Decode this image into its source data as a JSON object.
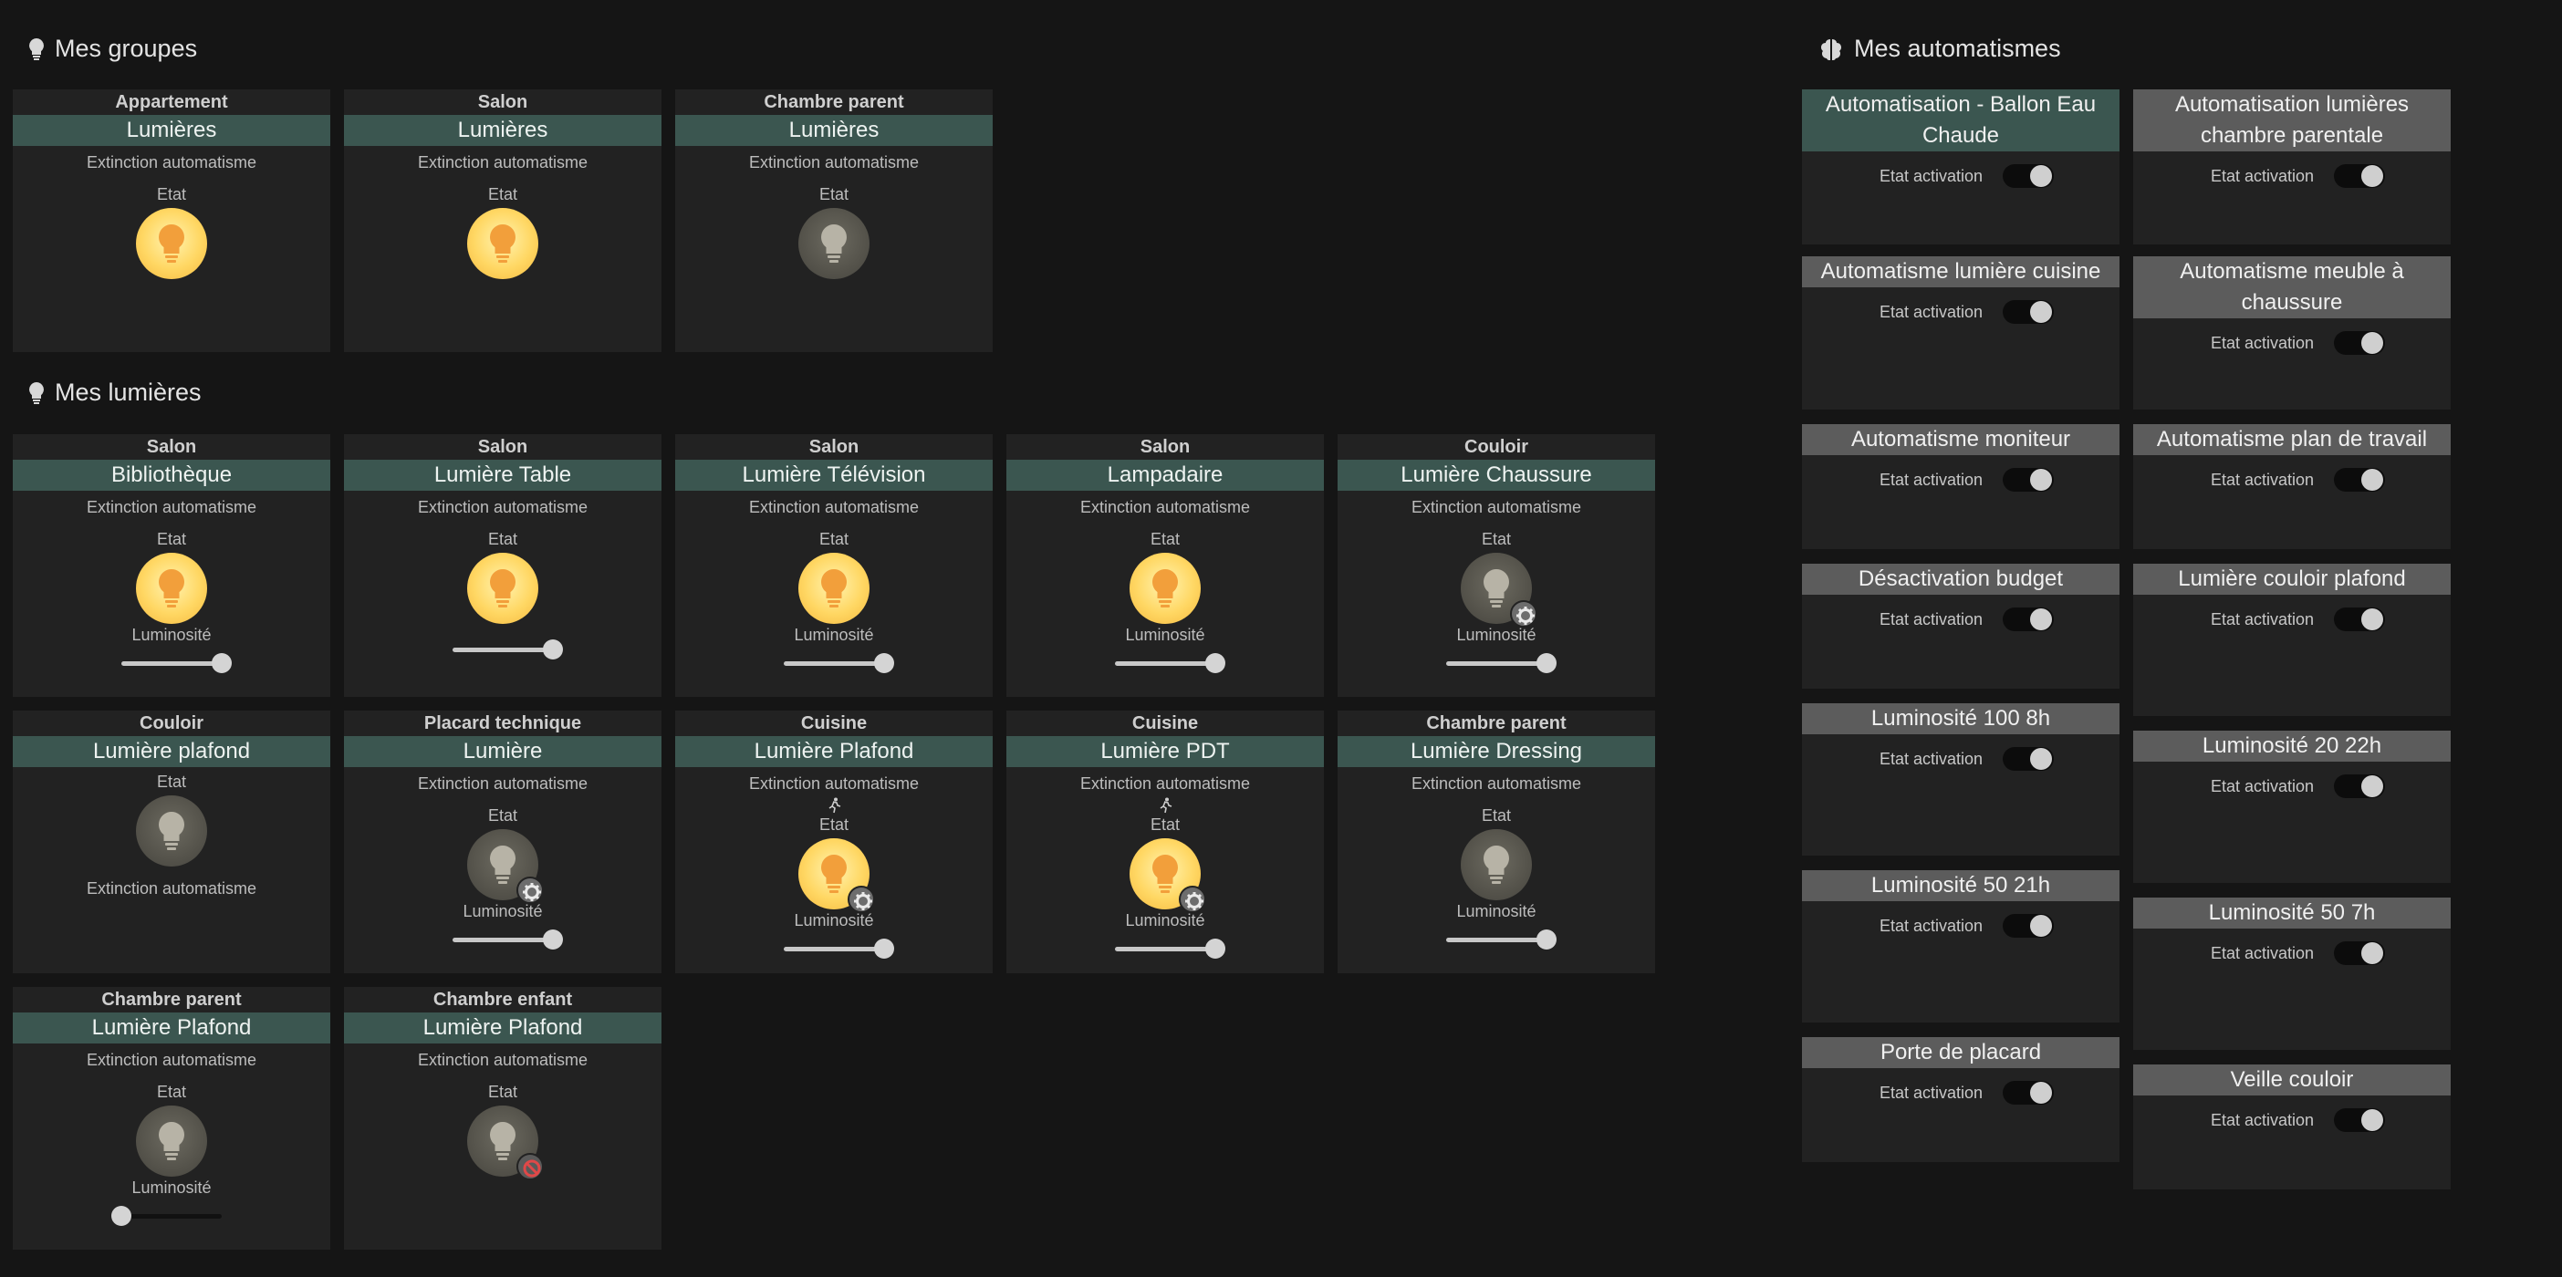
{
  "sections": {
    "groups_title": "Mes groupes",
    "lights_title": "Mes lumières",
    "automations_title": "Mes automatismes"
  },
  "groups": [
    {
      "room": "Appartement",
      "name": "Lumières",
      "sub": "Extinction automatisme",
      "etat": "Etat",
      "state": "on"
    },
    {
      "room": "Salon",
      "name": "Lumières",
      "sub": "Extinction automatisme",
      "etat": "Etat",
      "state": "on"
    },
    {
      "room": "Chambre parent",
      "name": "Lumières",
      "sub": "Extinction automatisme",
      "etat": "Etat",
      "state": "off"
    }
  ],
  "lights": [
    {
      "room": "Salon",
      "name": "Bibliothèque",
      "sub": "Extinction automatisme",
      "etat": "Etat",
      "luminosite": "Luminosité",
      "state": "on",
      "level": 100
    },
    {
      "room": "Salon",
      "name": "Lumière Table",
      "sub": "Extinction automatisme",
      "etat": "Etat",
      "luminosite": "",
      "state": "on",
      "level": 100
    },
    {
      "room": "Salon",
      "name": "Lumière Télévision",
      "sub": "Extinction automatisme",
      "etat": "Etat",
      "luminosite": "Luminosité",
      "state": "on",
      "level": 100
    },
    {
      "room": "Salon",
      "name": "Lampadaire",
      "sub": "Extinction automatisme",
      "etat": "Etat",
      "luminosite": "Luminosité",
      "state": "on",
      "level": 100
    },
    {
      "room": "Couloir",
      "name": "Lumière Chaussure",
      "sub": "Extinction automatisme",
      "etat": "Etat",
      "luminosite": "Luminosité",
      "state": "off",
      "badge": "gear",
      "level": 100
    },
    {
      "room": "Couloir",
      "name": "Lumière plafond",
      "sub": "",
      "etat": "Etat",
      "luminosite": "",
      "state": "off",
      "footer": "Extinction automatisme"
    },
    {
      "room": "Placard technique",
      "name": "Lumière",
      "sub": "Extinction automatisme",
      "etat": "Etat",
      "luminosite": "Luminosité",
      "state": "off",
      "badge": "gear",
      "level": 100
    },
    {
      "room": "Cuisine",
      "name": "Lumière Plafond",
      "sub": "Extinction automatisme",
      "etat": "Etat",
      "luminosite": "Luminosité",
      "state": "on",
      "badge": "gear",
      "runner": true,
      "level": 100
    },
    {
      "room": "Cuisine",
      "name": "Lumière PDT",
      "sub": "Extinction automatisme",
      "etat": "Etat",
      "luminosite": "Luminosité",
      "state": "on",
      "badge": "gear",
      "runner": true,
      "level": 100
    },
    {
      "room": "Chambre parent",
      "name": "Lumière Dressing",
      "sub": "Extinction automatisme",
      "etat": "Etat",
      "luminosite": "Luminosité",
      "state": "off",
      "level": 100
    },
    {
      "room": "Chambre parent",
      "name": "Lumière Plafond",
      "sub": "Extinction automatisme",
      "etat": "Etat",
      "luminosite": "Luminosité",
      "state": "off",
      "level": 0
    },
    {
      "room": "Chambre enfant",
      "name": "Lumière Plafond",
      "sub": "Extinction automatisme",
      "etat": "Etat",
      "luminosite": "",
      "state": "off",
      "badge": "forbidden"
    }
  ],
  "automations": [
    {
      "name": "Automatisation - Ballon Eau Chaude",
      "label": "Etat activation",
      "active": true
    },
    {
      "name": "Automatisation lumières chambre parentale",
      "label": "Etat activation",
      "active": false
    },
    {
      "name": "Automatisme lumière cuisine",
      "label": "Etat activation",
      "active": false
    },
    {
      "name": "Automatisme meuble à chaussure",
      "label": "Etat activation",
      "active": false
    },
    {
      "name": "Automatisme moniteur",
      "label": "Etat activation",
      "active": false
    },
    {
      "name": "Automatisme plan de travail",
      "label": "Etat activation",
      "active": false
    },
    {
      "name": "Désactivation budget",
      "label": "Etat activation",
      "active": false
    },
    {
      "name": "Lumière couloir plafond",
      "label": "Etat activation",
      "active": false
    },
    {
      "name": "Luminosité 100 8h",
      "label": "Etat activation",
      "active": false
    },
    {
      "name": "Luminosité 20 22h",
      "label": "Etat activation",
      "active": false
    },
    {
      "name": "Luminosité 50 21h",
      "label": "Etat activation",
      "active": false
    },
    {
      "name": "Luminosité 50 7h",
      "label": "Etat activation",
      "active": false
    },
    {
      "name": "Porte de placard",
      "label": "Etat activation",
      "active": false
    },
    {
      "name": "Veille couloir",
      "label": "Etat activation",
      "active": false
    }
  ],
  "icons": {
    "section_light": "lightbulb-icon",
    "section_auto": "brain-icon",
    "light_on": "lightbulb-on-icon",
    "light_off": "lightbulb-off-icon",
    "gear": "gear-icon",
    "forbidden": "forbidden-icon",
    "runner": "person-running-icon"
  },
  "colors": {
    "background": "#151515",
    "card": "#222222",
    "name_bar": "#3b5650",
    "auto_bar": "#5c5c5c",
    "bulb_on": "#ffd763",
    "bulb_off": "#55534b"
  }
}
